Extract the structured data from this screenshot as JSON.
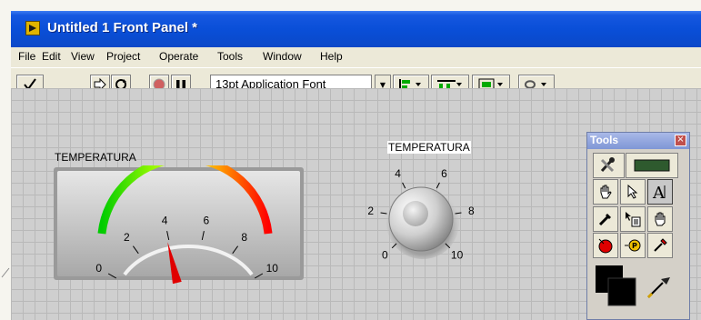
{
  "window": {
    "title": "Untitled 1 Front Panel *"
  },
  "menu": {
    "items": [
      "File",
      "Edit",
      "View",
      "Project",
      "Operate",
      "Tools",
      "Window",
      "Help"
    ]
  },
  "toolbar": {
    "font": "13pt Application Font"
  },
  "gauge": {
    "label": "TEMPERATURA",
    "min": 0,
    "max": 10,
    "value": 3.9,
    "ticks": [
      "0",
      "2",
      "4",
      "6",
      "8",
      "10"
    ],
    "colors": {
      "low": "#00cc00",
      "mid": "#ffee00",
      "high": "#ff0000"
    }
  },
  "knob": {
    "label": "TEMPERATURA",
    "ticks": [
      "0",
      "2",
      "4",
      "6",
      "8",
      "10"
    ]
  },
  "tools": {
    "title": "Tools",
    "close": "×",
    "items": [
      "automatic-selection-icon",
      "operate-value-icon",
      "position-size-select-icon",
      "edit-text-icon",
      "connect-wire-icon",
      "object-shortcut-menu-icon",
      "scroll-window-icon",
      "set-clear-breakpoint-icon",
      "probe-data-icon",
      "get-color-icon",
      "set-color-icon"
    ]
  }
}
